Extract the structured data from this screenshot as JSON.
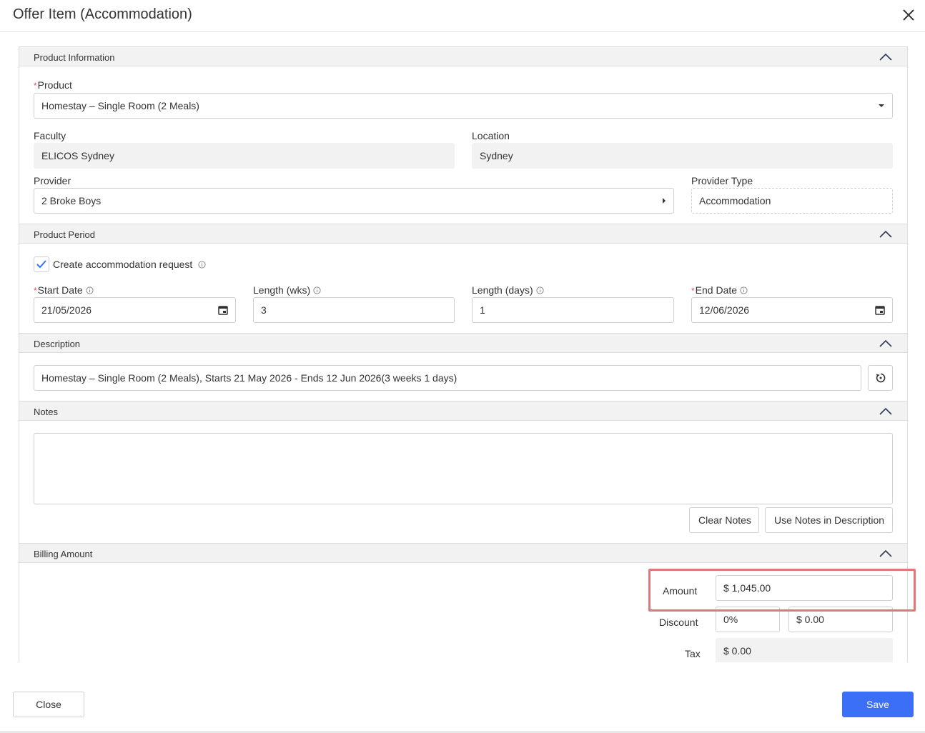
{
  "dialog": {
    "title": "Offer Item (Accommodation)"
  },
  "sections": {
    "product_information": "Product Information",
    "product_period": "Product Period",
    "description": "Description",
    "notes": "Notes",
    "billing_amount": "Billing Amount"
  },
  "product_info": {
    "product_label": "Product",
    "product_value": "Homestay – Single Room (2 Meals)",
    "faculty_label": "Faculty",
    "faculty_value": "ELICOS Sydney",
    "location_label": "Location",
    "location_value": "Sydney",
    "provider_label": "Provider",
    "provider_value": "2 Broke Boys",
    "provider_type_label": "Provider Type",
    "provider_type_value": "Accommodation"
  },
  "product_period": {
    "create_request_label": "Create accommodation request",
    "create_request_checked": true,
    "start_date_label": "Start Date",
    "start_date_value": "21/05/2026",
    "length_wks_label": "Length (wks)",
    "length_wks_value": "3",
    "length_days_label": "Length (days)",
    "length_days_value": "1",
    "end_date_label": "End Date",
    "end_date_value": "12/06/2026"
  },
  "description": {
    "value": "Homestay – Single Room (2 Meals), Starts 21 May 2026 - Ends 12 Jun 2026(3 weeks 1 days)"
  },
  "notes": {
    "value": "",
    "clear_label": "Clear Notes",
    "use_in_description_label": "Use Notes in Description"
  },
  "billing": {
    "amount_label": "Amount",
    "amount_value": "$ 1,045.00",
    "discount_label": "Discount",
    "discount_percent": "0%",
    "discount_amount": "$ 0.00",
    "tax_label": "Tax",
    "tax_value": "$ 0.00"
  },
  "footer": {
    "close_label": "Close",
    "save_label": "Save"
  },
  "colors": {
    "accent": "#3b6ff5",
    "highlight": "#e0787a",
    "required": "#d9534f",
    "section_bg": "#f2f2f2"
  }
}
